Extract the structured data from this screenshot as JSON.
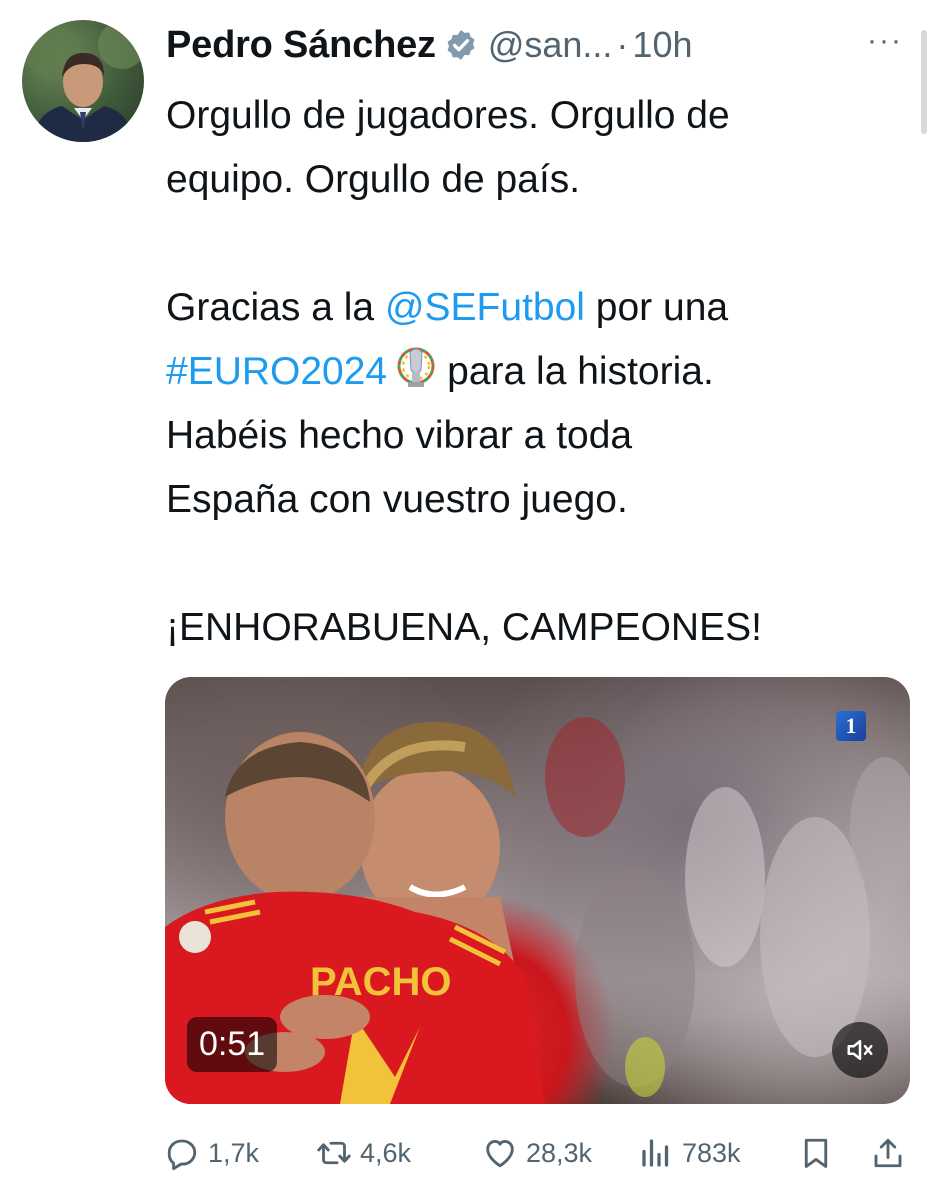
{
  "author": {
    "name": "Pedro Sánchez",
    "handle": "@san...",
    "separator": "·",
    "time": "10h",
    "more": "···"
  },
  "tweet": {
    "line1": "Orgullo de jugadores. Orgullo de",
    "line2": "equipo. Orgullo de país.",
    "p2_prefix": "Gracias a la",
    "mention": "@SEFutbol",
    "p2_mid": "por una",
    "hashtag": "#EURO2024",
    "p2_after_emoji": "para la historia.",
    "line6": "Habéis hecho vibrar a toda",
    "line7": "España con vuestro juego.",
    "closing": "¡ENHORABUENA, CAMPEONES!"
  },
  "media": {
    "duration": "0:51",
    "channel_logo": "1",
    "jersey_text": "PACHO",
    "mute_icon": "speaker-muted-icon"
  },
  "actions": {
    "replies": "1,7k",
    "retweets": "4,6k",
    "likes": "28,3k",
    "views": "783k"
  },
  "colors": {
    "link": "#1d9bf0",
    "text": "#0f1419",
    "secondary": "#536471",
    "verified": "#829aab"
  }
}
